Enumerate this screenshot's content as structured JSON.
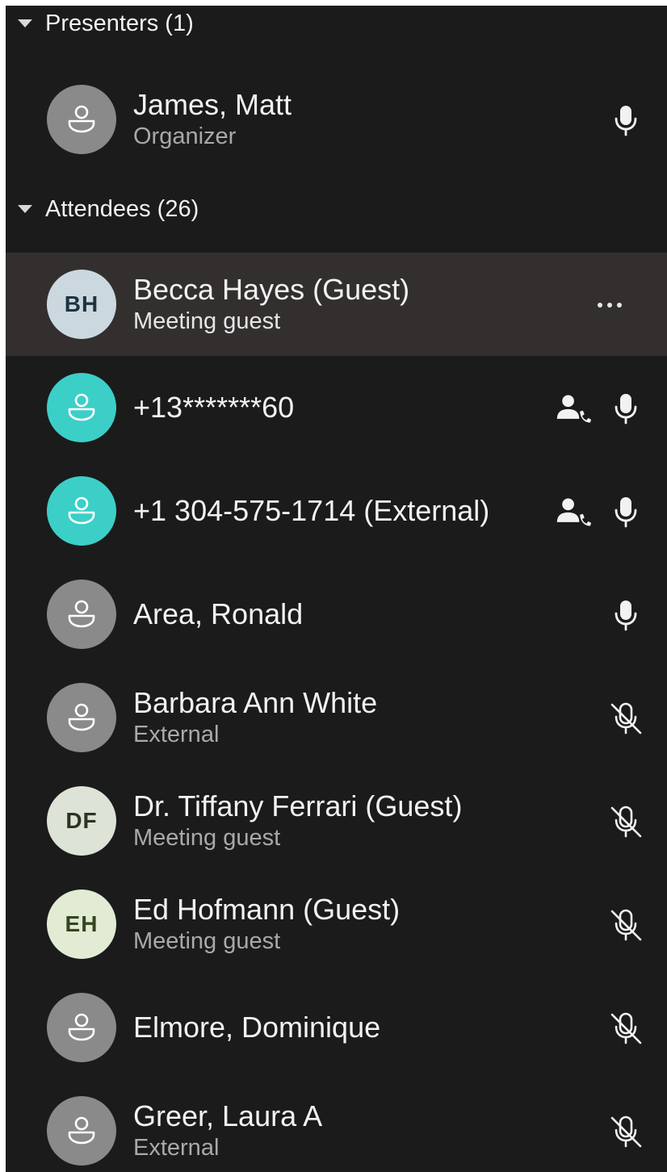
{
  "sections": {
    "presenters": {
      "label": "Presenters (1)"
    },
    "attendees": {
      "label": "Attendees (26)"
    }
  },
  "colors": {
    "panel_bg": "#1b1b1b",
    "selected_row_bg": "#332f2f",
    "avatar_grey": "#8a8a8a",
    "avatar_teal": "#3ccfc7"
  },
  "presenters": [
    {
      "name": "James, Matt",
      "subtitle": "Organizer",
      "avatar": "person-icon",
      "status_icon": "microphone-icon"
    }
  ],
  "attendees": [
    {
      "name": "Becca Hayes (Guest)",
      "subtitle": "Meeting guest",
      "initials": "BH",
      "initials_bg": "#ccd8df",
      "initials_color": "#1e3440",
      "status_icon": "more-options-icon"
    },
    {
      "name": "+13*******60",
      "subtitle": "",
      "avatar": "person-icon",
      "extra_icon": "phone-user-icon",
      "status_icon": "microphone-icon"
    },
    {
      "name": "+1 304-575-1714 (External)",
      "subtitle": "",
      "avatar": "person-icon",
      "extra_icon": "phone-user-icon",
      "status_icon": "microphone-icon"
    },
    {
      "name": "Area, Ronald",
      "subtitle": "",
      "avatar": "person-icon",
      "status_icon": "microphone-icon"
    },
    {
      "name": "Barbara Ann White",
      "subtitle": "External",
      "avatar": "person-icon",
      "status_icon": "microphone-muted-icon"
    },
    {
      "name": "Dr. Tiffany Ferrari (Guest)",
      "subtitle": "Meeting guest",
      "initials": "DF",
      "initials_bg": "#dde3d6",
      "initials_color": "#2b3522",
      "status_icon": "microphone-muted-icon"
    },
    {
      "name": "Ed Hofmann (Guest)",
      "subtitle": "Meeting guest",
      "initials": "EH",
      "initials_bg": "#e2ebd4",
      "initials_color": "#37451f",
      "status_icon": "microphone-muted-icon"
    },
    {
      "name": "Elmore, Dominique",
      "subtitle": "",
      "avatar": "person-icon",
      "status_icon": "microphone-muted-icon"
    },
    {
      "name": "Greer, Laura A",
      "subtitle": "External",
      "avatar": "person-icon",
      "status_icon": "microphone-muted-icon"
    }
  ]
}
